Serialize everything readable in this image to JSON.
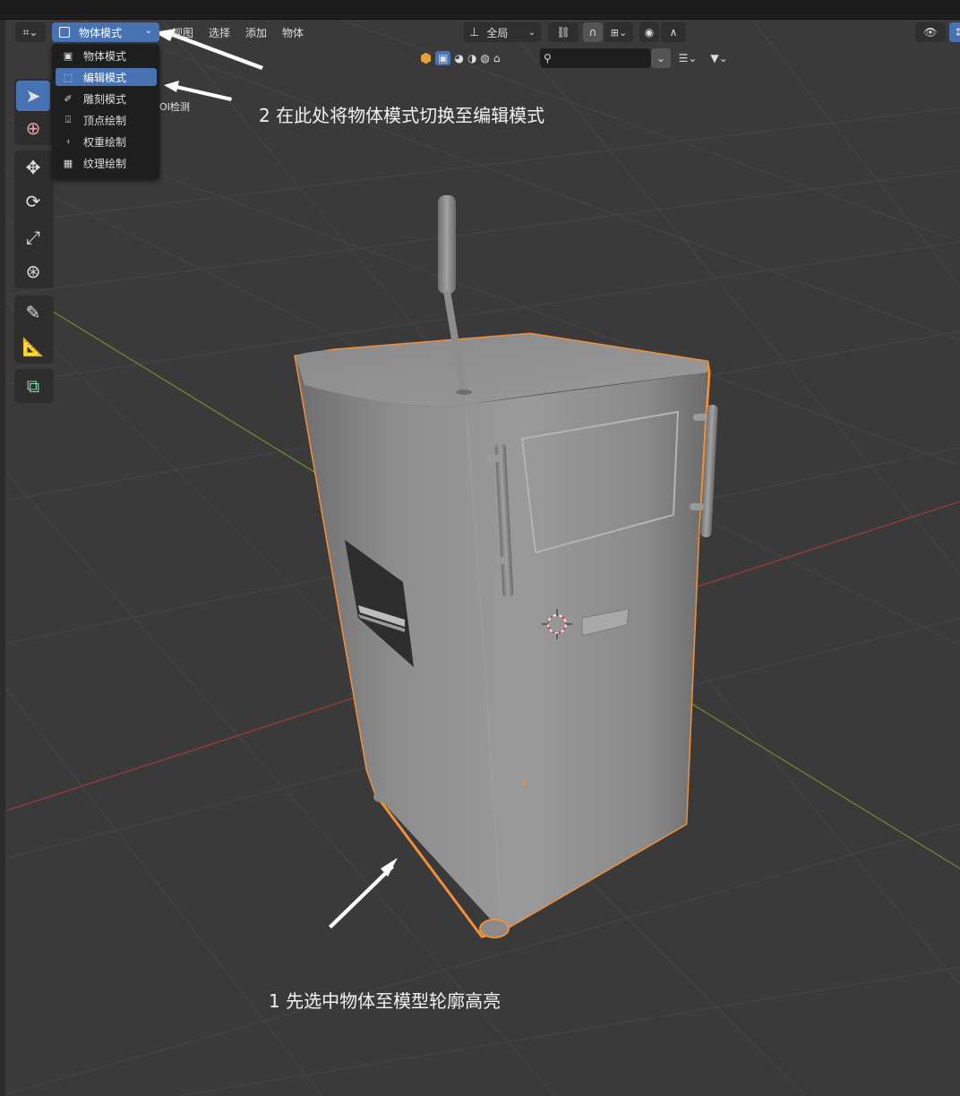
{
  "header": {
    "mode_selected": "物体模式",
    "menus": [
      "视图",
      "选择",
      "添加",
      "物体"
    ],
    "transform_orientation": "全局"
  },
  "mode_dropdown": {
    "items": [
      {
        "label": "物体模式",
        "icon": "object-mode-icon",
        "selected": false
      },
      {
        "label": "编辑模式",
        "icon": "edit-mode-icon",
        "selected": true
      },
      {
        "label": "雕刻模式",
        "icon": "sculpt-mode-icon",
        "selected": false
      },
      {
        "label": "顶点绘制",
        "icon": "vertex-paint-icon",
        "selected": false
      },
      {
        "label": "权重绘制",
        "icon": "weight-paint-icon",
        "selected": false
      },
      {
        "label": "纹理绘制",
        "icon": "texture-paint-icon",
        "selected": false
      }
    ]
  },
  "partial_label": "OI检测",
  "annotations": {
    "step2": "2 在此处将物体模式切换至编辑模式",
    "step1": "1 先选中物体至模型轮廓高亮"
  },
  "colors": {
    "accent": "#4772b3",
    "selection_outline": "#f0903a",
    "x_axis": "#9a3b3b",
    "y_axis": "#6a8a2e",
    "background": "#3a3a3a"
  }
}
